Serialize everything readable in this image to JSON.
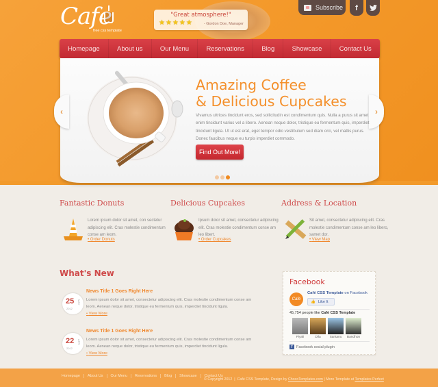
{
  "brand": {
    "logo_text": "Cafe",
    "tagline": "free css template"
  },
  "testimonial": {
    "quote": "\"Great atmosphere!\"",
    "stars": 5,
    "author": "- Gordon Doe, Manager"
  },
  "social": {
    "subscribe_label": "Subscribe",
    "facebook_glyph": "f",
    "twitter_glyph": "t"
  },
  "nav": {
    "items": [
      "Homepage",
      "About us",
      "Our Menu",
      "Reservations",
      "Blog",
      "Showcase",
      "Contact Us"
    ]
  },
  "slider": {
    "title_line1": "Amazing Coffee",
    "title_line2": "& Delicious Cupcakes",
    "text": "Vivamus ultrices tincidunt eros, sed sollicitudin est condimentum quis. Nulla a purus sit amet enim tincidunt varius vel a libero. Aenean neque dolor, tristique eu fermentum quis, imperdiet tincidunt ligula. Ut ut est erat, eget tempor odio vestibulum sed diam orci, vel mattis purus. Donec faucibus neque eu turpis imperdiet commodo.",
    "cta_label": "Find Out More!",
    "prev_glyph": "‹",
    "next_glyph": "›",
    "slide_count": 3,
    "active_slide": 3
  },
  "features": [
    {
      "title": "Fantastic Donuts",
      "icon": "traffic-cone-icon",
      "text": "Lorem ipsum dolor sit amet, con sectetur adipiscing elit. Cras molestie condimentum conse am leom.",
      "link": "Order Donuts"
    },
    {
      "title": "Delicious Cupcakes",
      "icon": "cupcake-icon",
      "text": "Ipsum dolor sit amet, consectetur adipiscing elit. Cras molestie condimentum conse am leo libert.",
      "link": "Order Cupcakes"
    },
    {
      "title": "Address & Location",
      "icon": "ruler-pencil-icon",
      "text": "Sit amet, consectetur adipiscing elit. Cras molestie condimentum conse am leo libero, samet dor.",
      "link": "View Map"
    }
  ],
  "news": {
    "heading": "What's New",
    "items": [
      {
        "day": "25",
        "month": "MAY",
        "year": "2012",
        "title": "News Title 1 Goes Right Here",
        "text": "Lorem ipsum dolor sit amet, consectetur adipiscing elit. Cras molestie condimentum conse am leom. Aenean neque dolor, tristique eu fermentum quis, imperdiet tincidunt ligula.",
        "link": "View More"
      },
      {
        "day": "22",
        "month": "APR",
        "year": "2012",
        "title": "News Title 1 Goes Right Here",
        "text": "Lorem ipsum dolor sit amet, consectetur adipiscing elit. Cras molestie condimentum conse am leom. Aenean neque dolor, tristique eu fermentum quis, imperdiet tincidunt ligula.",
        "link": "View More"
      }
    ]
  },
  "facebook": {
    "heading": "Facebook",
    "logo_text": "Café",
    "page_name": "Café CSS Template",
    "page_suffix": "on Facebook",
    "like_label": "Like It",
    "like_count": "45,754",
    "like_text": "people like",
    "fans": [
      "Piyali",
      "Dila",
      "Santanu",
      "Bandhon"
    ],
    "plugin_label": "Facebook social plugin"
  },
  "footer": {
    "nav": [
      "Homepage",
      "About Us",
      "Our Menu",
      "Reservations",
      "Blog",
      "Showcase",
      "Contact Us"
    ],
    "copyright": "© Copyright 2012",
    "credit_prefix": "Café CSS Template, Design by",
    "credit_link": "ChocoTemplates.com",
    "more_prefix": "| More Template at",
    "more_link": "Templates Perfect"
  },
  "colors": {
    "accent_orange": "#f4902c",
    "nav_red": "#c9343c",
    "heading_red": "#cf4b4b",
    "brown": "#5e4a44"
  }
}
